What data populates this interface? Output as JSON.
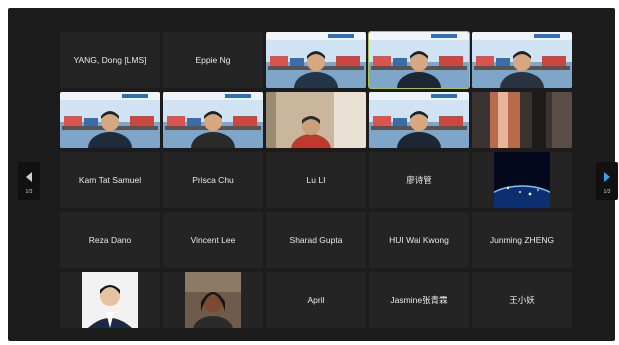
{
  "participants": [
    {
      "name": "YANG, Dong [LMS]",
      "kind": "name"
    },
    {
      "name": "Eppie Ng",
      "kind": "name"
    },
    {
      "name": "",
      "kind": "banner-person"
    },
    {
      "name": "",
      "kind": "banner-person",
      "active": true
    },
    {
      "name": "",
      "kind": "banner-person"
    },
    {
      "name": "",
      "kind": "banner-person"
    },
    {
      "name": "",
      "kind": "banner-person"
    },
    {
      "name": "",
      "kind": "room"
    },
    {
      "name": "",
      "kind": "banner-person"
    },
    {
      "name": "",
      "kind": "dark-room"
    },
    {
      "name": "Kam Tat Samuel",
      "kind": "name"
    },
    {
      "name": "Prisca Chu",
      "kind": "name"
    },
    {
      "name": "Lu LI",
      "kind": "name"
    },
    {
      "name": "廖诗管",
      "kind": "name"
    },
    {
      "name": "",
      "kind": "earth"
    },
    {
      "name": "Reza Dano",
      "kind": "name"
    },
    {
      "name": "Vincent Lee",
      "kind": "name"
    },
    {
      "name": "Sharad Gupta",
      "kind": "name"
    },
    {
      "name": "HUI Wai Kwong",
      "kind": "name"
    },
    {
      "name": "Junming ZHENG",
      "kind": "name"
    },
    {
      "name": "",
      "kind": "portrait-man"
    },
    {
      "name": "",
      "kind": "portrait-woman"
    },
    {
      "name": "April",
      "kind": "name"
    },
    {
      "name": "Jasmine张青霖",
      "kind": "name"
    },
    {
      "name": "王小妖",
      "kind": "name"
    }
  ],
  "navigation": {
    "prev_page": "1/3",
    "next_page": "1/3",
    "prev_icon": "triangle-left-icon",
    "next_icon": "triangle-right-icon"
  },
  "colors": {
    "background": "#1c1c1c",
    "tile": "#242424",
    "active_border": "#a9c15a",
    "next_arrow": "#3aa0e8"
  }
}
